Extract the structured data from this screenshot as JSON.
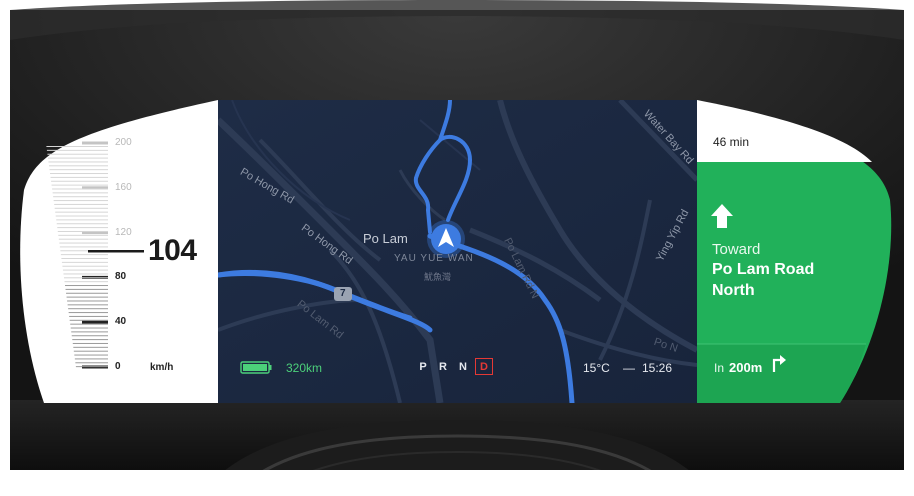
{
  "speedometer": {
    "speed": "104",
    "unit": "km/h",
    "scale": [
      {
        "label": "200",
        "emphasized": false
      },
      {
        "label": "160",
        "emphasized": false
      },
      {
        "label": "120",
        "emphasized": false
      },
      {
        "label": "80",
        "emphasized": true
      },
      {
        "label": "40",
        "emphasized": true
      },
      {
        "label": "0",
        "emphasized": true
      }
    ]
  },
  "status_bar": {
    "range": "320km",
    "gears": [
      "P",
      "R",
      "N",
      "D"
    ],
    "active_gear": "D",
    "temperature": "15°C",
    "separator": "—",
    "time": "15:26"
  },
  "map": {
    "current_place": "Po Lam",
    "district": "YAU YUE WAN",
    "district_zh": "魷魚灣",
    "street_labels": [
      "Po Hong Rd",
      "Po Hong Rd",
      "Po Lam Rd",
      "Ying Yip Rd",
      "Water Bay Rd",
      "Po Lam Rd N",
      "Po N"
    ],
    "route_badge": "7"
  },
  "navigation": {
    "eta": "46 min",
    "toward_label": "Toward",
    "street_line1": "Po Lam Road",
    "street_line2": "North",
    "distance_prefix": "In",
    "distance": "200m",
    "maneuver_icon": "turn-right-icon",
    "direction_icon": "arrow-up-icon"
  },
  "colors": {
    "nav_green": "#21b15a",
    "map_bg": "#1c2a44",
    "route_blue": "#3d7be0",
    "gear_active": "#e53935",
    "battery_green": "#4cd07a"
  }
}
